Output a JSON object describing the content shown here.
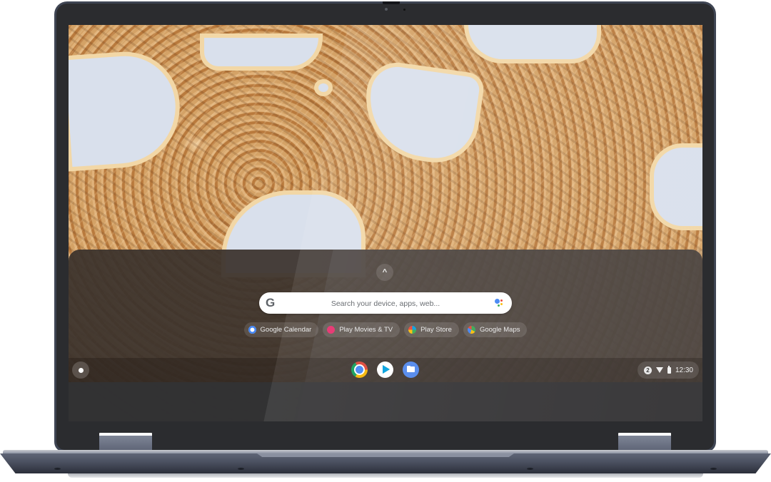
{
  "device": {
    "type": "Chromebook convertible laptop",
    "frame_color": "#3f4553"
  },
  "wallpaper": {
    "description": "Aerial desert sand dunes with icy salt pans",
    "colors": {
      "sand": "#c98d50",
      "ice": "#d9e0ec",
      "rim": "#f2d7a6"
    }
  },
  "launcher": {
    "expand_button": {
      "icon": "chevron-up-icon",
      "glyph": "^"
    },
    "search": {
      "placeholder": "Search your device, apps, web...",
      "value": "",
      "left_icon": "google-g-icon",
      "left_glyph": "G",
      "right_icon": "google-assistant-icon"
    },
    "suggestions": [
      {
        "label": "Google Calendar",
        "icon": "google-calendar-icon",
        "color": "#4285f4"
      },
      {
        "label": "Play Movies & TV",
        "icon": "play-movies-icon",
        "color": "#e52d6b"
      },
      {
        "label": "Play Store",
        "icon": "play-store-icon",
        "color": "#00a0e0"
      },
      {
        "label": "Google Maps",
        "icon": "google-maps-icon",
        "color": "#34a853"
      }
    ]
  },
  "shelf": {
    "launcher_button": {
      "icon": "launcher-circle-icon"
    },
    "pinned_apps": [
      {
        "name": "Chrome",
        "icon": "chrome-icon"
      },
      {
        "name": "Play Store",
        "icon": "play-store-icon"
      },
      {
        "name": "Files",
        "icon": "files-folder-icon"
      }
    ],
    "status_tray": {
      "notification_count": "2",
      "wifi_icon": "wifi-icon",
      "battery_icon": "battery-icon",
      "time": "12:30"
    }
  }
}
